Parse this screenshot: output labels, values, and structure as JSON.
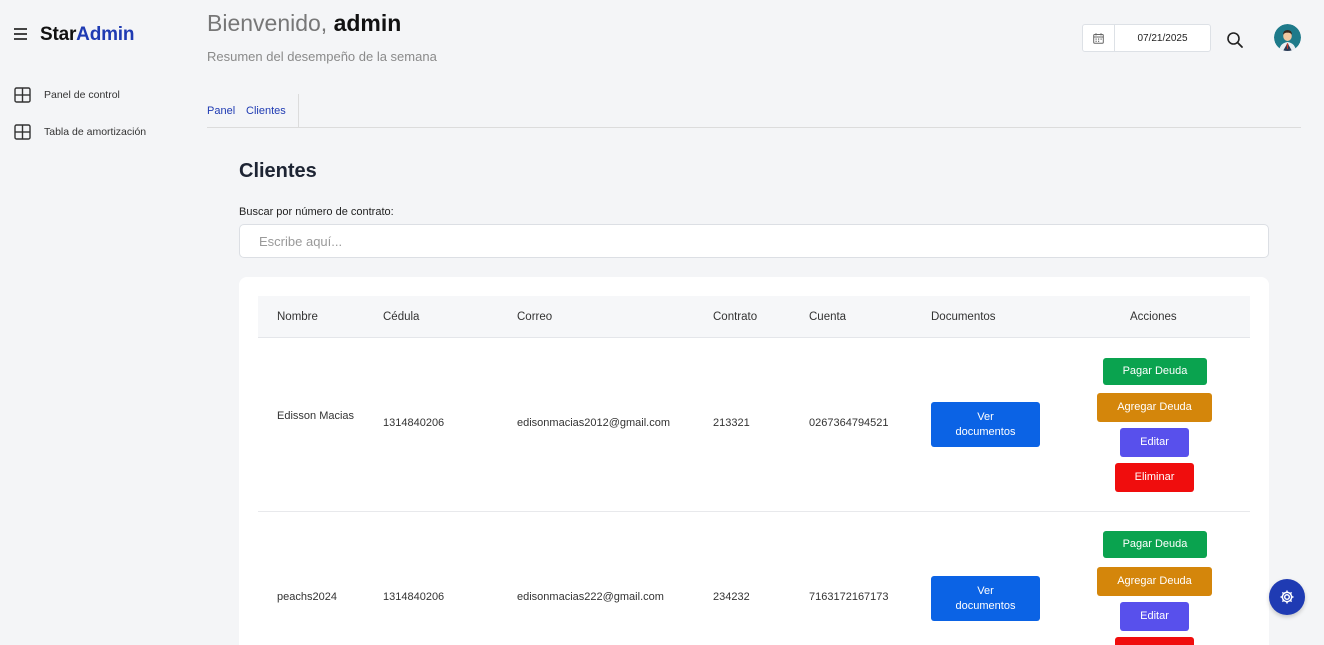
{
  "brand": {
    "part1": "Star",
    "part2": "Admin"
  },
  "sidebar": {
    "items": [
      {
        "label": "Panel de control",
        "icon": "grid-icon"
      },
      {
        "label": "Tabla de amortización",
        "icon": "grid-icon"
      }
    ]
  },
  "header": {
    "greeting": "Bienvenido,",
    "username": "admin",
    "subtitle": "Resumen del desempeño de la semana",
    "date": "07/21/2025"
  },
  "tabs": [
    {
      "label": "Panel"
    },
    {
      "label": "Clientes"
    }
  ],
  "main": {
    "title": "Clientes",
    "search_label": "Buscar por número de contrato:",
    "search_placeholder": "Escribe aquí...",
    "search_value": ""
  },
  "table": {
    "headers": [
      "Nombre",
      "Cédula",
      "Correo",
      "Contrato",
      "Cuenta",
      "Documentos",
      "Acciones"
    ],
    "rows": [
      {
        "nombre": "Edisson Macias",
        "cedula": "1314840206",
        "correo": "edisonmacias2012@gmail.com",
        "contrato": "213321",
        "cuenta": "0267364794521"
      },
      {
        "nombre": "peachs2024",
        "cedula": "1314840206",
        "correo": "edisonmacias222@gmail.com",
        "contrato": "234232",
        "cuenta": "7163172167173"
      }
    ],
    "buttons": {
      "docs": "Ver documentos",
      "pay": "Pagar Deuda",
      "add": "Agregar Deuda",
      "edit": "Editar",
      "delete": "Eliminar"
    }
  },
  "colors": {
    "brand": "#1f3bb3",
    "docs": "#0b63e5",
    "pay": "#0aa34f",
    "add": "#d4860b",
    "edit": "#5850ec",
    "delete": "#f00d0d"
  }
}
